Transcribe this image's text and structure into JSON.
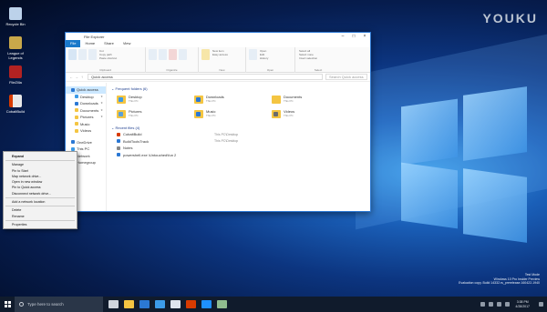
{
  "watermark": "YOUKU",
  "desktop_icons": [
    {
      "label": "Recycle Bin",
      "icon": "recycle-bin-icon"
    },
    {
      "label": "League of Legends",
      "icon": "league-icon"
    },
    {
      "label": "FileZilla",
      "icon": "filezilla-icon"
    },
    {
      "label": "CobaltBuild",
      "icon": "cobaltbuild-icon"
    }
  ],
  "window": {
    "title": "File Explorer",
    "tabs": [
      "File",
      "Home",
      "Share",
      "View"
    ],
    "ribbon": {
      "groups": [
        {
          "label": "Clipboard",
          "items": [
            "Pin to Quick access",
            "Copy",
            "Paste",
            "Cut",
            "Copy path",
            "Paste shortcut"
          ]
        },
        {
          "label": "Organize",
          "items": [
            "Move to",
            "Copy to",
            "Delete",
            "Rename"
          ]
        },
        {
          "label": "New",
          "items": [
            "New folder",
            "New item",
            "Easy access"
          ]
        },
        {
          "label": "Open",
          "items": [
            "Properties",
            "Open",
            "Edit",
            "History"
          ]
        },
        {
          "label": "Select",
          "items": [
            "Select all",
            "Select none",
            "Invert selection"
          ]
        }
      ]
    },
    "address": {
      "path": "Quick access",
      "search_placeholder": "Search Quick access"
    },
    "nav": [
      {
        "label": "Quick access",
        "sub": false,
        "sel": true,
        "icon": "star-icon",
        "color": "#2b78d4"
      },
      {
        "label": "Desktop",
        "sub": true,
        "icon": "desktop-icon",
        "color": "#3c9be8",
        "pin": "★"
      },
      {
        "label": "Downloads",
        "sub": true,
        "icon": "downloads-icon",
        "color": "#2b78d4",
        "pin": "★"
      },
      {
        "label": "Documents",
        "sub": true,
        "icon": "documents-icon",
        "color": "#f4c542",
        "pin": "★"
      },
      {
        "label": "Pictures",
        "sub": true,
        "icon": "pictures-icon",
        "color": "#f4c542",
        "pin": "★"
      },
      {
        "label": "Music",
        "sub": true,
        "icon": "music-icon",
        "color": "#f4c542",
        "pin": ""
      },
      {
        "label": "Videos",
        "sub": true,
        "icon": "videos-icon",
        "color": "#f4c542",
        "pin": ""
      },
      {
        "label": "OneDrive",
        "sub": false,
        "icon": "onedrive-icon",
        "color": "#2b78d4",
        "pin": ""
      },
      {
        "label": "This PC",
        "sub": false,
        "icon": "this-pc-icon",
        "color": "#3c9be8",
        "pin": ""
      },
      {
        "label": "Network",
        "sub": false,
        "icon": "network-icon",
        "color": "#3c9be8",
        "pin": ""
      },
      {
        "label": "Homegroup",
        "sub": false,
        "icon": "homegroup-icon",
        "color": "#3c9be8",
        "pin": ""
      }
    ],
    "frequent_header": "Frequent folders (6)",
    "frequent": [
      {
        "name": "Desktop",
        "sub": "This PC",
        "overlay": "#3c9be8"
      },
      {
        "name": "Downloads",
        "sub": "This PC",
        "overlay": "#2b78d4"
      },
      {
        "name": "Documents",
        "sub": "This PC",
        "overlay": ""
      },
      {
        "name": "Pictures",
        "sub": "This PC",
        "overlay": "#5aa0d8"
      },
      {
        "name": "Music",
        "sub": "This PC",
        "overlay": "#2b78d4"
      },
      {
        "name": "Videos",
        "sub": "This PC",
        "overlay": "#6b6b6b"
      }
    ],
    "recent_header": "Recent files (4)",
    "recent": [
      {
        "name": "CobaltBuild",
        "path": "This PC\\Desktop",
        "color": "#d83b01"
      },
      {
        "name": "BuildToolsTrack",
        "path": "This PC\\Desktop",
        "color": "#2b78d4"
      },
      {
        "name": "Notes",
        "path": "",
        "color": "#888888"
      },
      {
        "name": "powershell.exe \\Untouched\\fun 2",
        "path": "",
        "color": "#2b78d4"
      }
    ]
  },
  "context_menu": {
    "items": [
      {
        "label": "Expand",
        "bold": true
      },
      {
        "sep": true
      },
      {
        "label": "Manage"
      },
      {
        "label": "Pin to Start"
      },
      {
        "label": "Map network drive..."
      },
      {
        "label": "Open in new window"
      },
      {
        "label": "Pin to Quick access"
      },
      {
        "label": "Disconnect network drive..."
      },
      {
        "sep": true
      },
      {
        "label": "Add a network location"
      },
      {
        "sep": true
      },
      {
        "label": "Delete"
      },
      {
        "label": "Rename"
      },
      {
        "sep": true
      },
      {
        "label": "Properties"
      }
    ]
  },
  "testmode": {
    "line1": "Test Mode",
    "line2": "Windows 10 Pro Insider Preview",
    "line3": "Evaluation copy. Build 14332.rs_prerelease.160422-1940"
  },
  "taskbar": {
    "search_placeholder": "Type here to search",
    "apps": [
      {
        "icon": "task-view-icon",
        "color": "#d0d6de"
      },
      {
        "icon": "file-explorer-icon",
        "color": "#f4c542"
      },
      {
        "icon": "edge-icon",
        "color": "#2b78d4"
      },
      {
        "icon": "store-icon",
        "color": "#3c9be8"
      },
      {
        "icon": "mail-icon",
        "color": "#dfe5ee"
      },
      {
        "icon": "office-icon",
        "color": "#d83b01"
      },
      {
        "icon": "media-icon",
        "color": "#1e90ff"
      },
      {
        "icon": "app-icon",
        "color": "#8fbc8f"
      }
    ],
    "time": "3:38 PM",
    "date": "4/28/2017"
  }
}
